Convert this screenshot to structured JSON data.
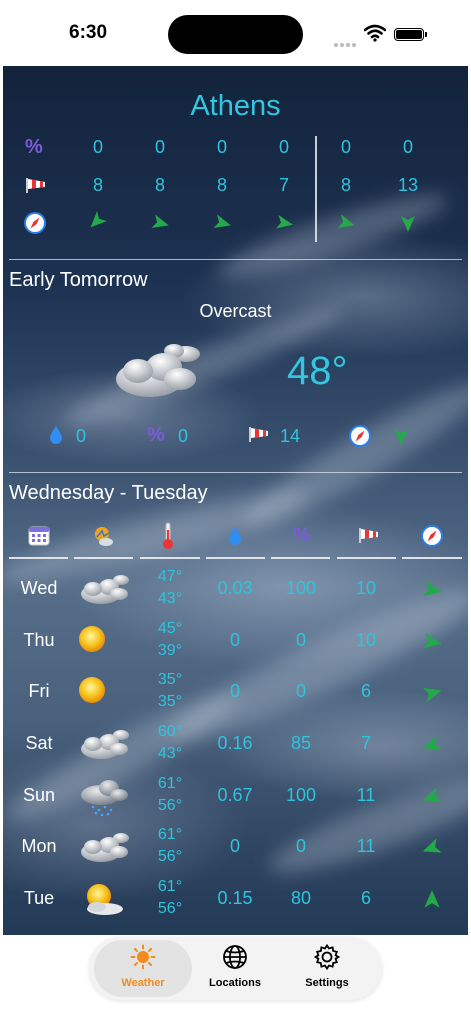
{
  "status_bar": {
    "time": "6:30"
  },
  "city": "Athens",
  "hourly": {
    "precip_chance": [
      "0",
      "0",
      "0",
      "0",
      "0",
      "0"
    ],
    "wind_speed": [
      "8",
      "8",
      "8",
      "7",
      "8",
      "13"
    ]
  },
  "early_tomorrow": {
    "title": "Early Tomorrow",
    "condition": "Overcast",
    "temp": "48°",
    "precip": "0",
    "precip_chance": "0",
    "wind": "14"
  },
  "weekly": {
    "title": "Wednesday - Tuesday",
    "days": [
      {
        "day": "Wed",
        "hi": "47°",
        "lo": "43°",
        "precip": "0.03",
        "chance": "100",
        "wind": "10",
        "icon": "cloud-icon"
      },
      {
        "day": "Thu",
        "hi": "45°",
        "lo": "39°",
        "precip": "0",
        "chance": "0",
        "wind": "10",
        "icon": "sun-icon"
      },
      {
        "day": "Fri",
        "hi": "35°",
        "lo": "35°",
        "precip": "0",
        "chance": "0",
        "wind": "6",
        "icon": "sun-icon"
      },
      {
        "day": "Sat",
        "hi": "60°",
        "lo": "43°",
        "precip": "0.16",
        "chance": "85",
        "wind": "7",
        "icon": "cloud-icon"
      },
      {
        "day": "Sun",
        "hi": "61°",
        "lo": "56°",
        "precip": "0.67",
        "chance": "100",
        "wind": "11",
        "icon": "rain-cloud-icon"
      },
      {
        "day": "Mon",
        "hi": "61°",
        "lo": "56°",
        "precip": "0",
        "chance": "0",
        "wind": "11",
        "icon": "cloud-icon"
      },
      {
        "day": "Tue",
        "hi": "61°",
        "lo": "56°",
        "precip": "0.15",
        "chance": "80",
        "wind": "6",
        "icon": "partly-sunny-icon"
      }
    ]
  },
  "tabs": [
    {
      "label": "Weather",
      "icon": "sun-icon",
      "selected": true
    },
    {
      "label": "Locations",
      "icon": "globe-icon",
      "selected": false
    },
    {
      "label": "Settings",
      "icon": "gear-icon",
      "selected": false
    }
  ],
  "colors": {
    "accent": "#2ec4dc",
    "arrow": "#23a84a",
    "tab_selected": "#f28c1c"
  }
}
